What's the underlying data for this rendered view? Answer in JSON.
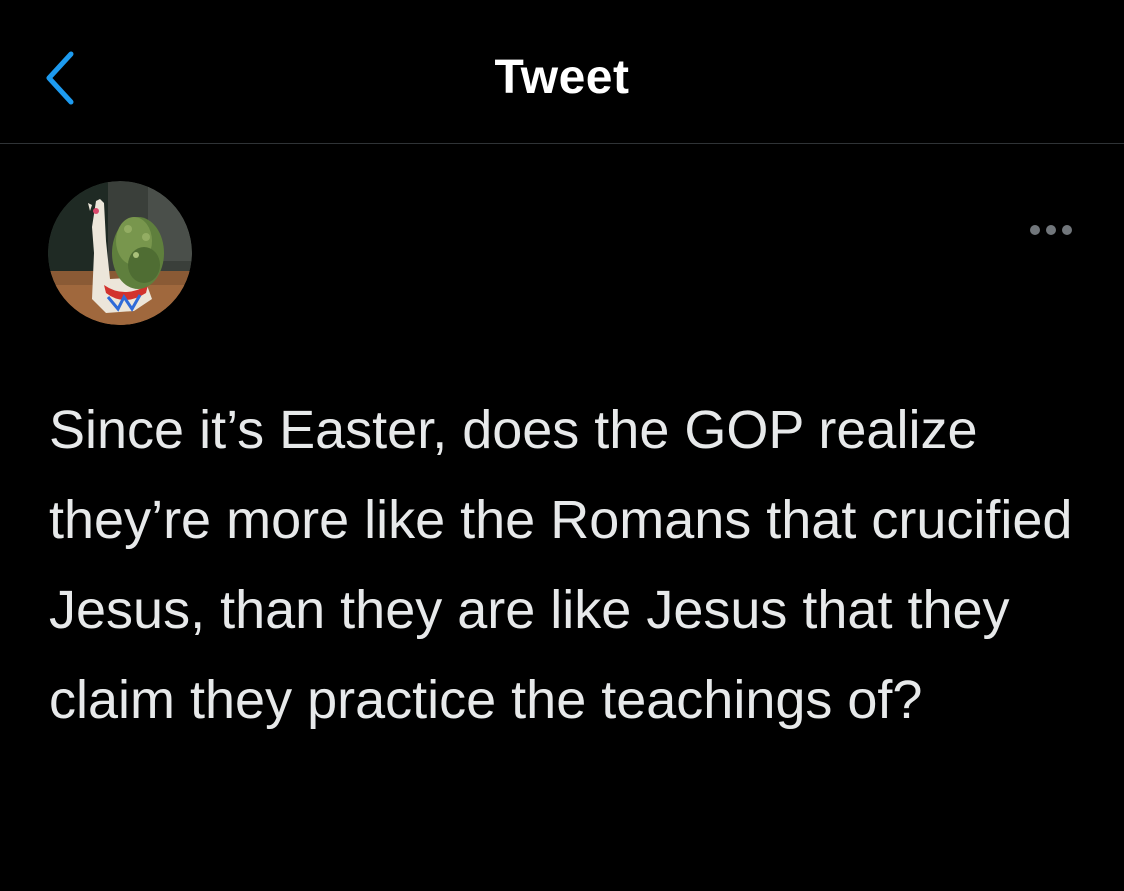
{
  "header": {
    "title": "Tweet",
    "back_icon": "chevron-left-icon",
    "accent_color": "#1d9bf0"
  },
  "tweet": {
    "avatar_description_icon": "avatar-llama-planter",
    "more_icon": "more-horizontal-icon",
    "text": "Since it’s Easter, does the GOP realize they’re more like the Romans that crucified Jesus, than they are like Jesus that they claim they practice the teachings of?"
  },
  "colors": {
    "background": "#000000",
    "text": "#e7e9ea",
    "divider": "#2f3336",
    "icon_gray": "#71767b"
  }
}
